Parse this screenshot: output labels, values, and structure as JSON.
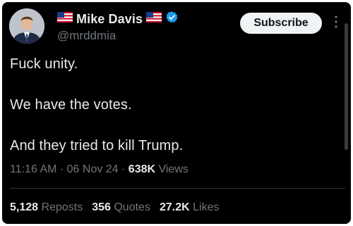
{
  "author": {
    "display_name": "Mike Davis",
    "handle": "@mrddmia",
    "flag_icon": "us-flag-icon",
    "verified_icon": "verified-badge-icon",
    "verified_color": "#1d9bf0"
  },
  "subscribe_label": "Subscribe",
  "tweet": {
    "lines": [
      "Fuck unity.",
      "We have the votes.",
      "And they tried to kill Trump."
    ]
  },
  "meta": {
    "time": "11:16 AM",
    "sep1": " · ",
    "date": "06 Nov 24",
    "sep2": " · ",
    "views_count": "638K",
    "views_label": " Views"
  },
  "stats": {
    "reposts_count": "5,128",
    "reposts_label": "Reposts",
    "quotes_count": "356",
    "quotes_label": "Quotes",
    "likes_count": "27.2K",
    "likes_label": "Likes"
  },
  "colors": {
    "background": "#000000",
    "primary_text": "#e7e9ea",
    "secondary_text": "#71767b",
    "button_bg": "#eff3f4"
  }
}
